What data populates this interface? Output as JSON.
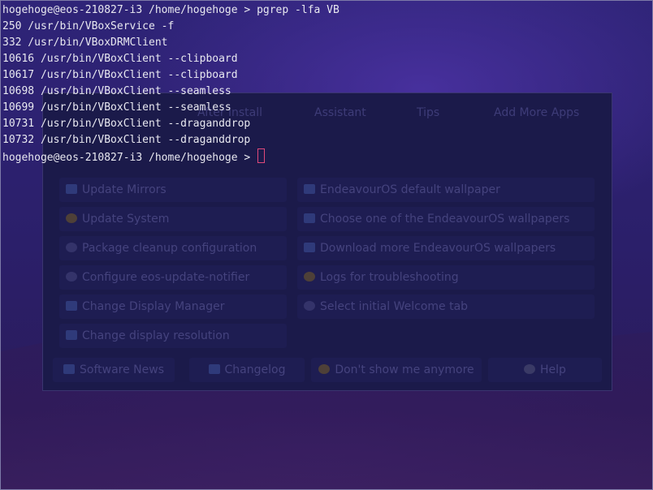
{
  "terminal": {
    "prompt": "hogehoge@eos-210827-i3 /home/hogehoge > ",
    "command": "pgrep -lfa VB",
    "output": [
      "250 /usr/bin/VBoxService -f",
      "332 /usr/bin/VBoxDRMClient",
      "10616 /usr/bin/VBoxClient --clipboard",
      "10617 /usr/bin/VBoxClient --clipboard",
      "10698 /usr/bin/VBoxClient --seamless",
      "10699 /usr/bin/VBoxClient --seamless",
      "10731 /usr/bin/VBoxClient --draganddrop",
      "10732 /usr/bin/VBoxClient --draganddrop"
    ],
    "final_prompt": "hogehoge@eos-210827-i3 /home/hogehoge > ",
    "cursor_color": "#e0497a"
  },
  "welcome": {
    "tabs": [
      "After install",
      "Assistant",
      "Tips",
      "Add More Apps"
    ],
    "items_left": [
      {
        "label": "Update Mirrors",
        "icon": "globe-icon"
      },
      {
        "label": "Update System",
        "icon": "update-icon"
      },
      {
        "label": "Package cleanup configuration",
        "icon": "gear-icon"
      },
      {
        "label": "Configure eos-update-notifier",
        "icon": "gear-icon"
      },
      {
        "label": "Change Display Manager",
        "icon": "display-icon"
      },
      {
        "label": "Change display resolution",
        "icon": "display-icon"
      }
    ],
    "items_right": [
      {
        "label": "EndeavourOS default wallpaper",
        "icon": "display-icon"
      },
      {
        "label": "Choose one of the EndeavourOS wallpapers",
        "icon": "display-icon"
      },
      {
        "label": "Download more EndeavourOS wallpapers",
        "icon": "display-icon"
      },
      {
        "label": "Logs for troubleshooting",
        "icon": "face-icon"
      },
      {
        "label": "Select initial Welcome tab",
        "icon": "gear-icon"
      }
    ],
    "bottom_buttons": [
      {
        "label": "Software News",
        "icon": "news-icon"
      },
      {
        "label": "Changelog",
        "icon": "news-icon"
      },
      {
        "label": "Don't show me anymore",
        "icon": "face-icon"
      },
      {
        "label": "Help",
        "icon": "help-icon"
      }
    ]
  },
  "colors": {
    "terminal_text": "#e8e8f0",
    "desktop_bg": "#2a1a66"
  }
}
